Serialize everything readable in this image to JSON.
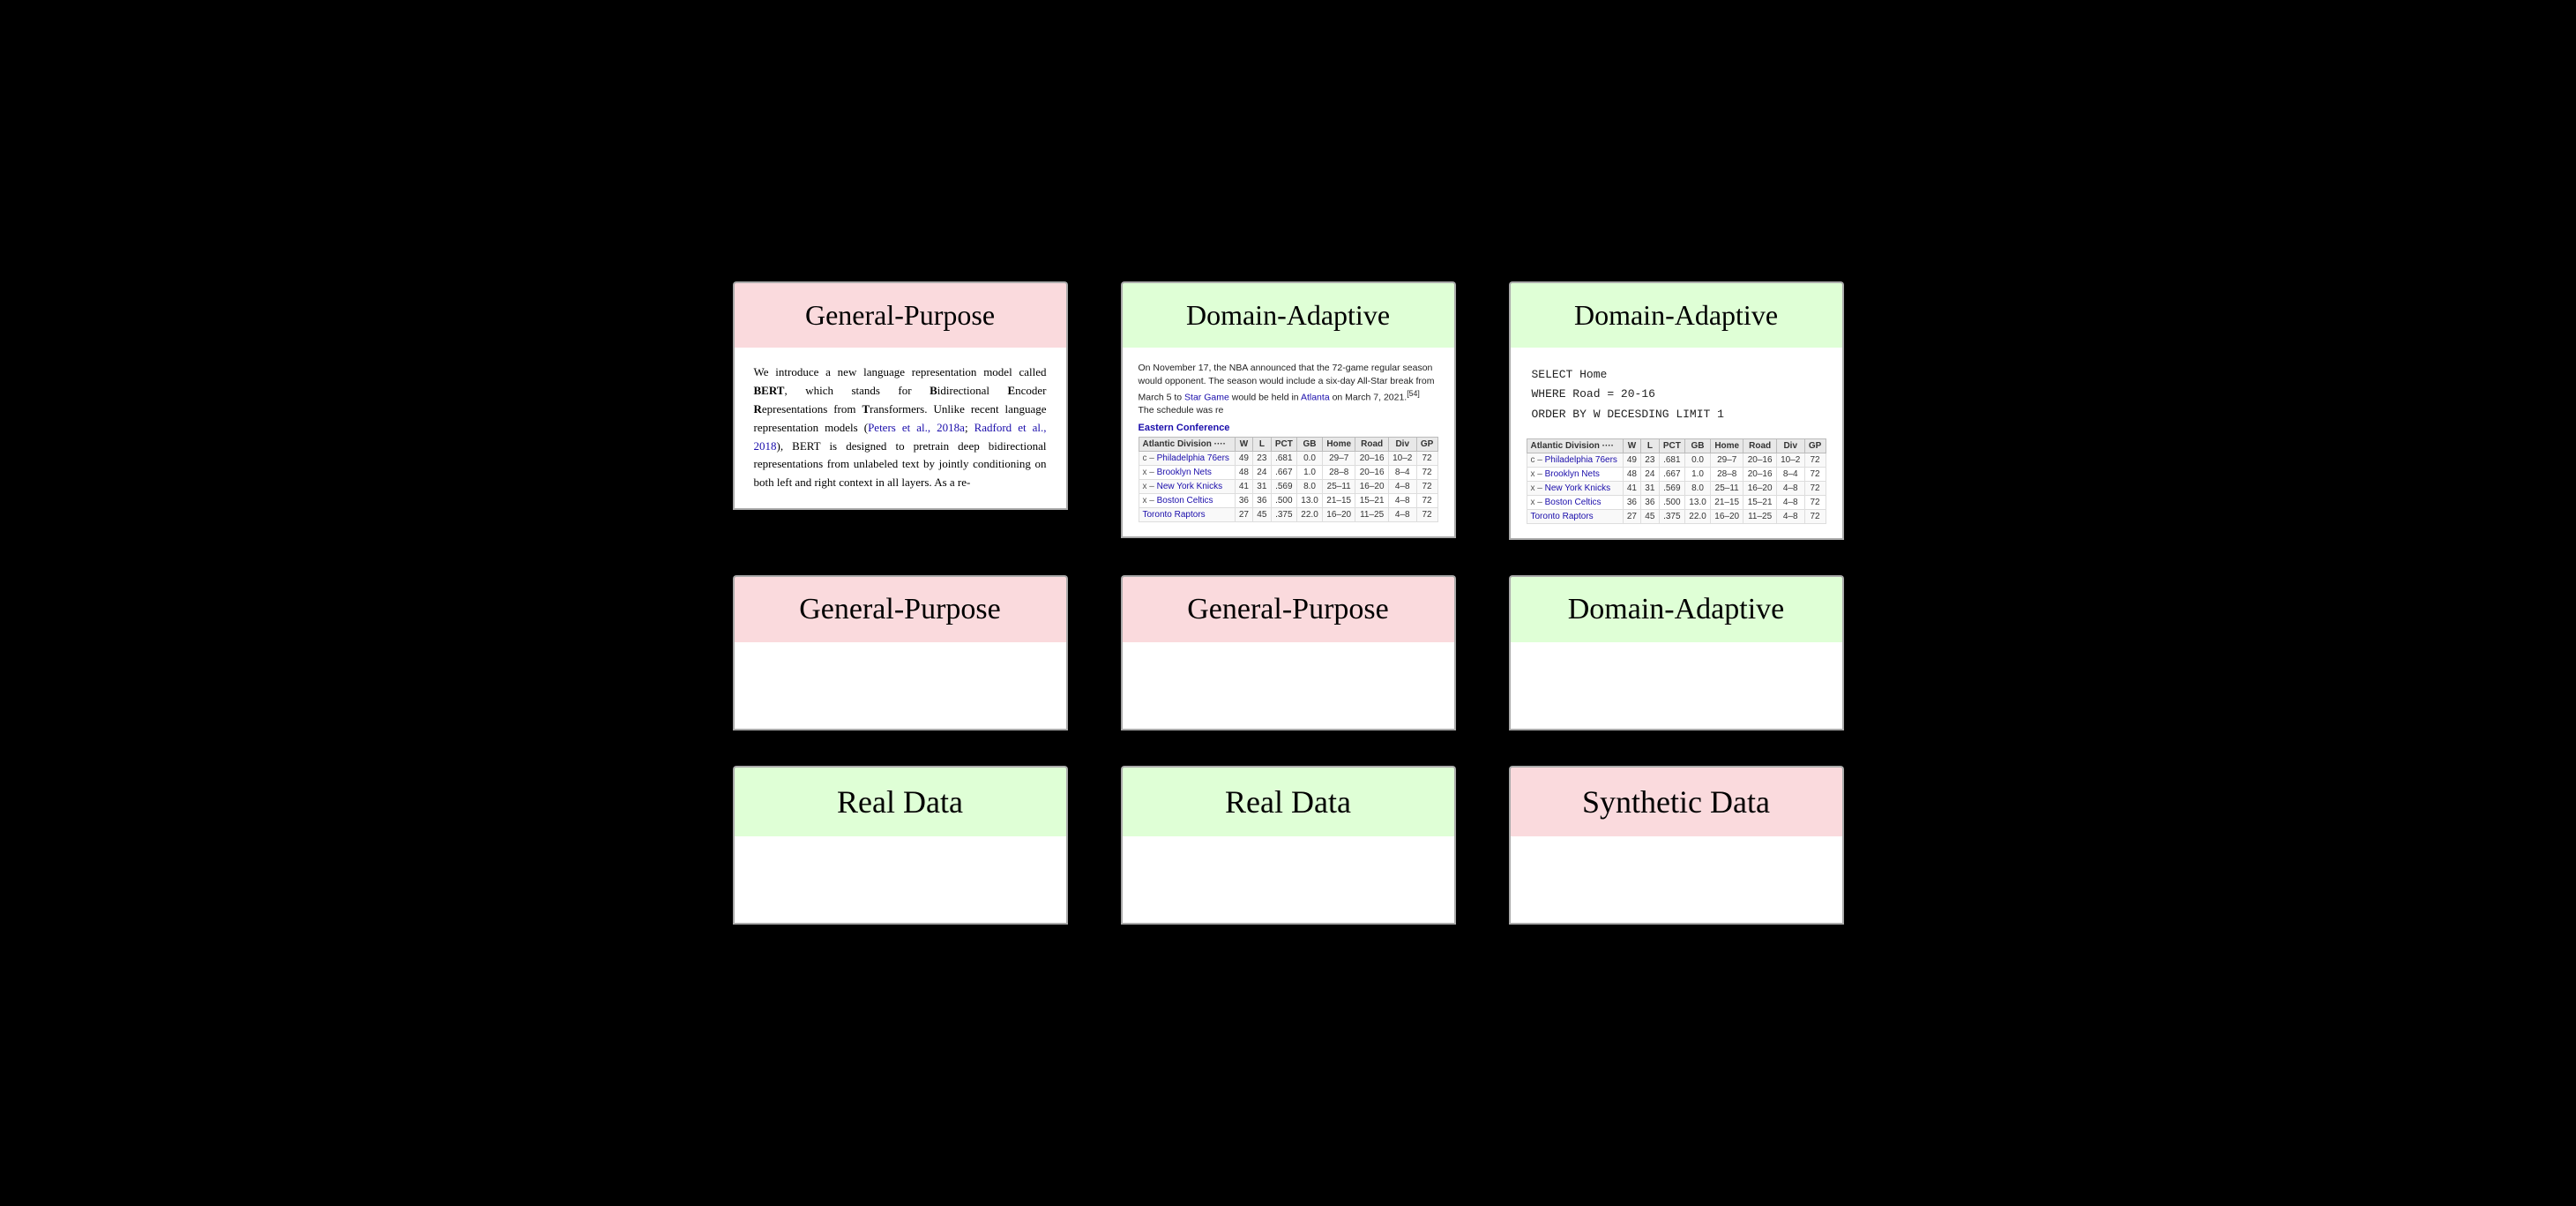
{
  "cards": {
    "row1": [
      {
        "id": "card-1-1",
        "header": {
          "text": "General-Purpose",
          "color": "salmon"
        },
        "type": "bert"
      },
      {
        "id": "card-1-2",
        "header": {
          "text": "Domain-Adaptive",
          "color": "green"
        },
        "type": "nba"
      },
      {
        "id": "card-1-3",
        "header": {
          "text": "Domain-Adaptive",
          "color": "green"
        },
        "type": "sql"
      }
    ],
    "row2": [
      {
        "id": "card-2-1",
        "header": {
          "text": "General-Purpose",
          "color": "salmon"
        },
        "type": "empty"
      },
      {
        "id": "card-2-2",
        "header": {
          "text": "General-Purpose",
          "color": "salmon"
        },
        "type": "empty"
      },
      {
        "id": "card-2-3",
        "header": {
          "text": "Domain-Adaptive",
          "color": "green"
        },
        "type": "empty"
      }
    ],
    "row3": [
      {
        "id": "card-3-1",
        "header": {
          "text": "Real Data",
          "color": "green"
        },
        "type": "empty"
      },
      {
        "id": "card-3-2",
        "header": {
          "text": "Real Data",
          "color": "green"
        },
        "type": "empty"
      },
      {
        "id": "card-3-3",
        "header": {
          "text": "Synthetic Data",
          "color": "salmon"
        },
        "type": "empty"
      }
    ]
  },
  "bert": {
    "text": "We introduce a new language representation model called BERT, which stands for Bidirectional Encoder Representations from Transformers. Unlike recent language representation models (Peters et al., 2018a; Radford et al., 2018), BERT is designed to pretrain deep bidirectional representations from unlabeled text by jointly conditioning on both left and right context in all layers. As a re-"
  },
  "nba": {
    "intro": "On November 17, the NBA announced that the 72-game regular season would opponent. The season would include a six-day All-Star break from March 5 to Star Game would be held in Atlanta on March 7, 2021.",
    "footnote": "[54]",
    "note2": "The schedule was re",
    "conference": "Eastern Conference",
    "division": "Atlantic Division",
    "columns": [
      "",
      "W",
      "L",
      "PCT",
      "GB",
      "Home",
      "Road",
      "Div",
      "GP"
    ],
    "rows": [
      {
        "prefix": "c –",
        "name": "Philadelphia 76ers",
        "w": "49",
        "l": "23",
        "pct": ".681",
        "gb": "0.0",
        "home": "29–7",
        "road": "20–16",
        "div": "10–2",
        "gp": "72"
      },
      {
        "prefix": "x –",
        "name": "Brooklyn Nets",
        "w": "48",
        "l": "24",
        "pct": ".667",
        "gb": "1.0",
        "home": "28–8",
        "road": "20–16",
        "div": "8–4",
        "gp": "72"
      },
      {
        "prefix": "x –",
        "name": "New York Knicks",
        "w": "41",
        "l": "31",
        "pct": ".569",
        "gb": "8.0",
        "home": "25–11",
        "road": "16–20",
        "div": "4–8",
        "gp": "72"
      },
      {
        "prefix": "x –",
        "name": "Boston Celtics",
        "w": "36",
        "l": "36",
        "pct": ".500",
        "gb": "13.0",
        "home": "21–15",
        "road": "15–21",
        "div": "4–8",
        "gp": "72"
      },
      {
        "prefix": "",
        "name": "Toronto Raptors",
        "w": "27",
        "l": "45",
        "pct": ".375",
        "gb": "22.0",
        "home": "16–20",
        "road": "11–25",
        "div": "4–8",
        "gp": "72"
      }
    ]
  },
  "sql_card": {
    "division": "Atlantic Division",
    "columns_label": "W  L  PCT  GB  Home  Road  Div  GP",
    "rows": [
      {
        "prefix": "c –",
        "name": "Philadelphia 76ers",
        "w": "49",
        "l": "23",
        "pct": ".681",
        "gb": "0.0",
        "home": "29–7",
        "road": "20–16",
        "div": "10–2",
        "gp": "72"
      },
      {
        "prefix": "x –",
        "name": "Brooklyn Nets",
        "w": "48",
        "l": "24",
        "pct": ".667",
        "gb": "1.0",
        "home": "28–8",
        "road": "20–16",
        "div": "8–4",
        "gp": "72"
      },
      {
        "prefix": "x –",
        "name": "New York Knicks",
        "w": "41",
        "l": "31",
        "pct": ".569",
        "gb": "8.0",
        "home": "25–11",
        "road": "16–20",
        "div": "4–8",
        "gp": "72"
      },
      {
        "prefix": "x –",
        "name": "Boston Celtics",
        "w": "36",
        "l": "36",
        "pct": ".500",
        "gb": "13.0",
        "home": "21–15",
        "road": "15–21",
        "div": "4–8",
        "gp": "72"
      },
      {
        "prefix": "",
        "name": "Toronto Raptors",
        "w": "27",
        "l": "45",
        "pct": ".375",
        "gb": "22.0",
        "home": "16–20",
        "road": "11–25",
        "div": "4–8",
        "gp": "72"
      }
    ],
    "query": "SELECT Home\nWHERE Road = 20-16\nORDER BY W DECESDING LIMIT 1"
  },
  "labels": {
    "row1_headers": [
      "General-Purpose",
      "Domain-Adaptive",
      "Domain-Adaptive"
    ],
    "row2_headers": [
      "General-Purpose",
      "General-Purpose",
      "Domain-Adaptive"
    ],
    "row3_headers": [
      "Real Data",
      "Real Data",
      "Synthetic Data"
    ]
  }
}
